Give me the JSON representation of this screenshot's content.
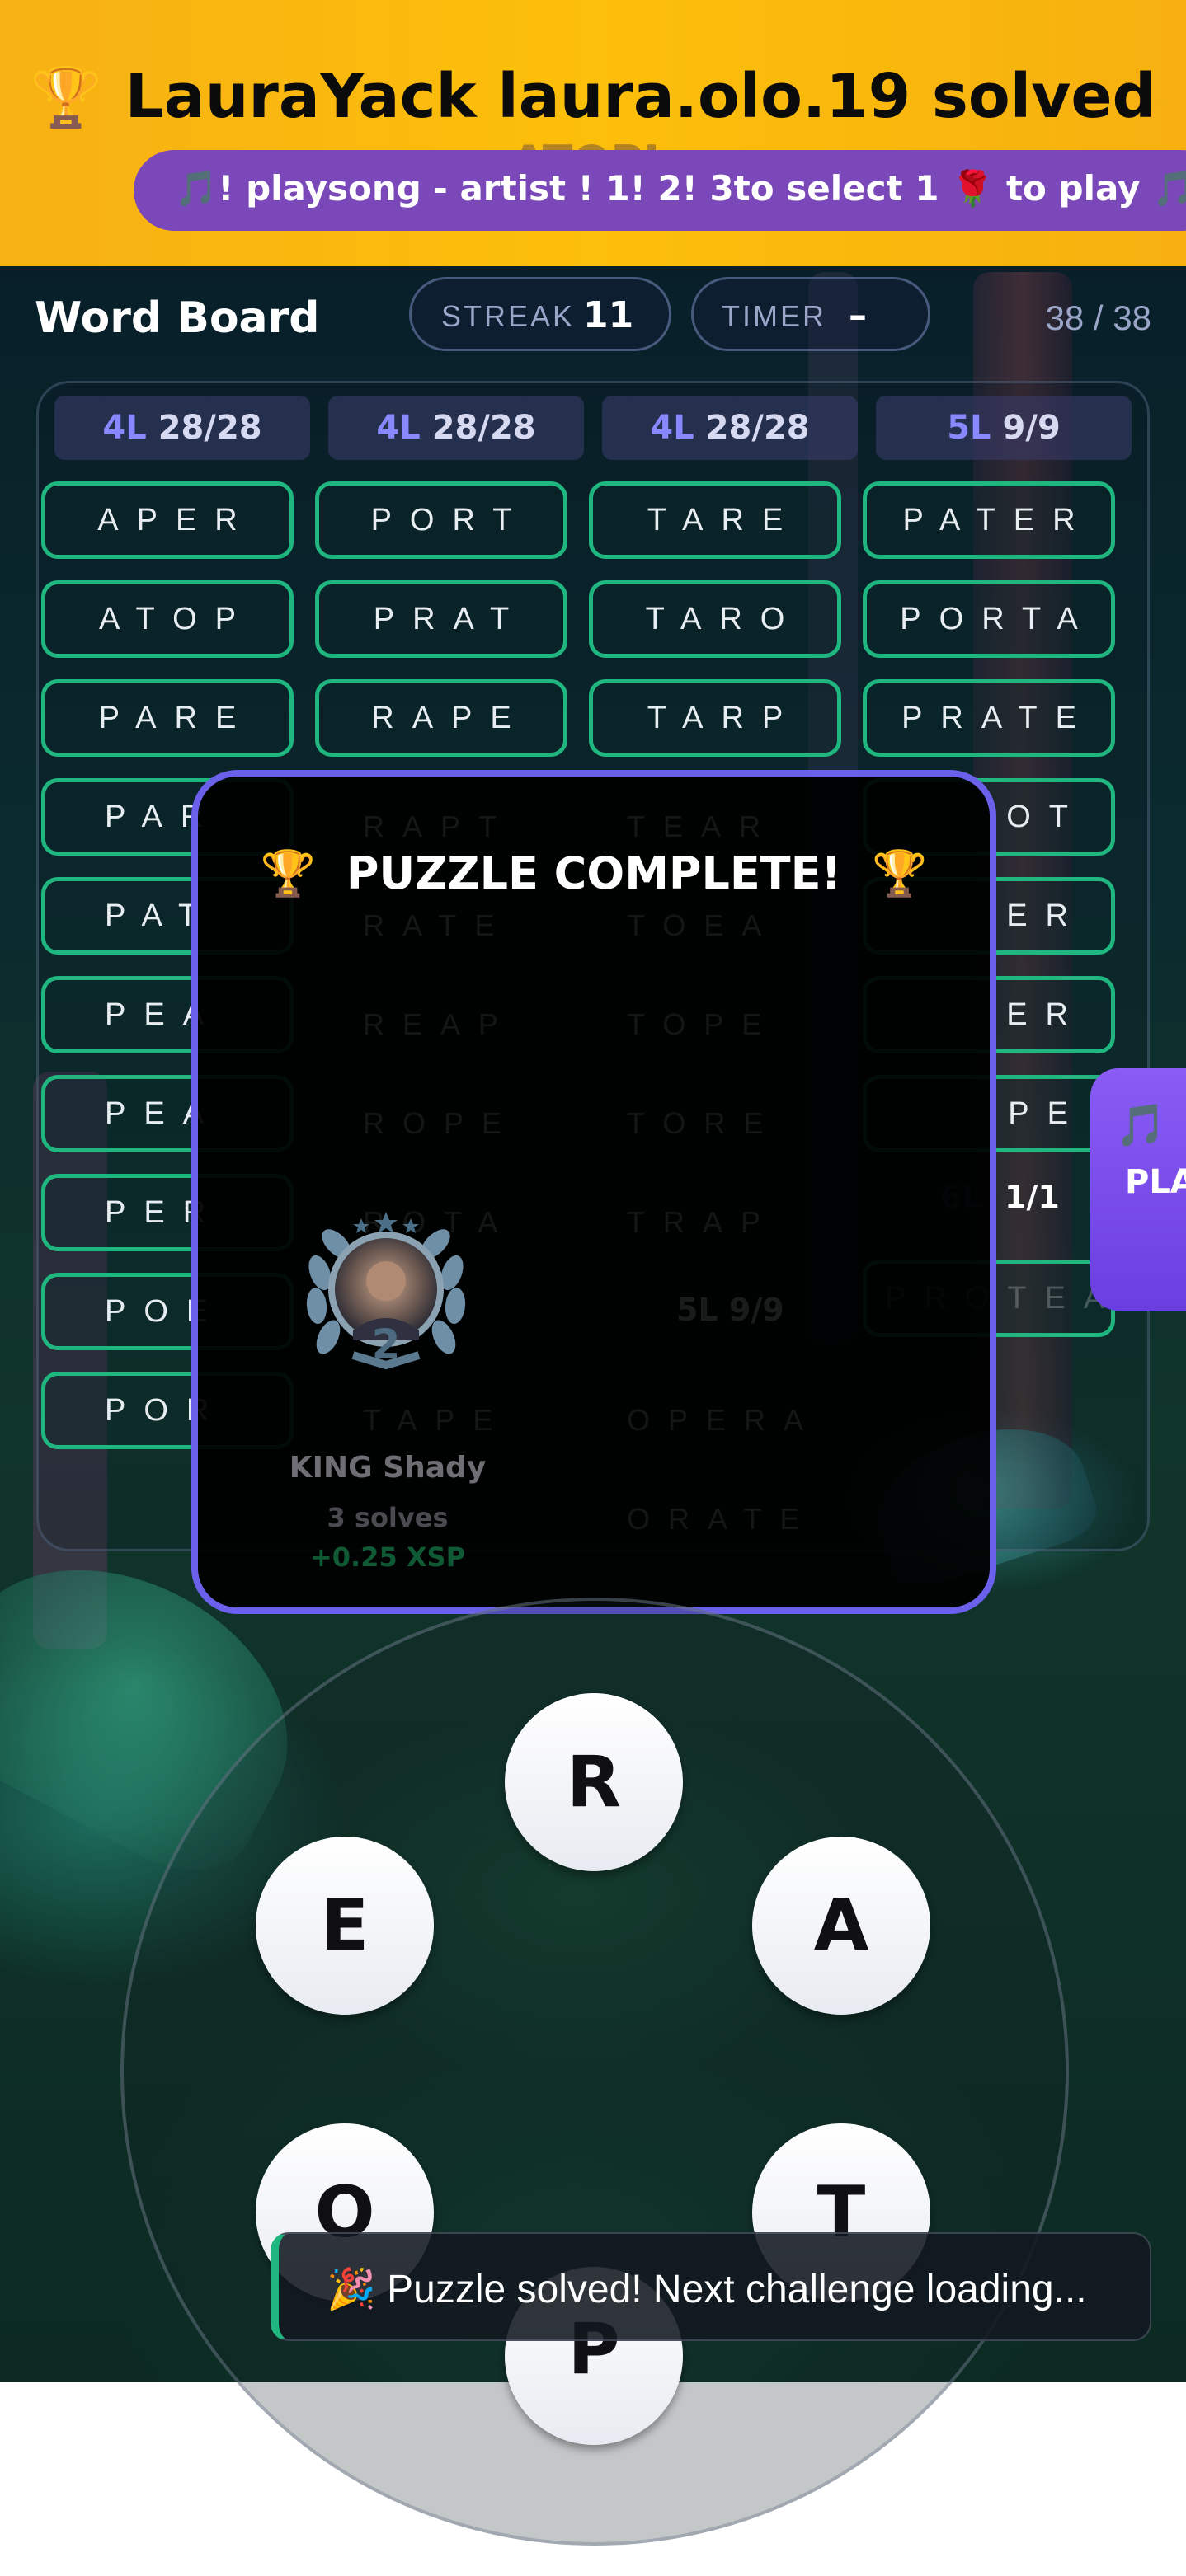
{
  "banner": {
    "title": "LauraYack laura.olo.19 solved",
    "ticker": "🎵! playsong - artist   ! 1! 2! 3to select   1 🌹 to play  🎵",
    "ghost_word": "ATOPI"
  },
  "header": {
    "board_title": "Word Board",
    "streak_label": "STREAK",
    "streak_value": "11",
    "timer_label": "TIMER",
    "timer_value": "–",
    "count": "38 / 38"
  },
  "columns": [
    {
      "len": "4L",
      "count": "28/28",
      "words": [
        "APER",
        "PART",
        "PATE",
        "PEAR",
        "PEAT",
        "PERT",
        "POET",
        "PORE"
      ]
    },
    {
      "len": "4L",
      "count": "28/28",
      "words": [
        "PORT",
        "PRAT",
        "RAPE"
      ]
    },
    {
      "len": "4L",
      "count": "28/28",
      "words": [
        "TARE",
        "TARO",
        "TARP"
      ]
    },
    {
      "len": "5L",
      "count": "9/9",
      "words": [
        "PATER",
        "PORTA",
        "PRATE"
      ]
    }
  ],
  "visible_words": {
    "col1": [
      "APER",
      "ATOP",
      "PARE",
      "PAR",
      "PAT",
      "PEA",
      "PEA",
      "PER",
      "POE",
      "POR"
    ],
    "col4_partial": [
      "OT",
      "ER",
      "ER",
      "PE"
    ],
    "col4_bottom": "PROTEA",
    "col4_sub_count": "1/1",
    "col4_sub_len": "6L",
    "col3_sub": "5L 9/9"
  },
  "modal": {
    "title": "PUZZLE COMPLETE!",
    "rank": "2",
    "winner_name": "KING Shady",
    "winner_solves": "3 solves",
    "winner_reward": "+0.25 XSP",
    "ghost_words": [
      "RAPT",
      "TEAR",
      "RATE",
      "TOEA",
      "REAP",
      "TOPE",
      "ROPE",
      "TORE",
      "ROTA",
      "TRAP",
      "OPERA",
      "TAPE",
      "ORATE"
    ]
  },
  "play_tab": {
    "note": "🎵",
    "text": "PLAY"
  },
  "wheel": {
    "letters": [
      "R",
      "A",
      "T",
      "P",
      "O",
      "E"
    ]
  },
  "toast": {
    "text": "🎉 Puzzle solved! Next challenge loading..."
  },
  "colors": {
    "accent": "#6a60ea",
    "word_border": "#1fb67f",
    "banner": "#fcbf0a",
    "ticker": "#7a48b8"
  }
}
